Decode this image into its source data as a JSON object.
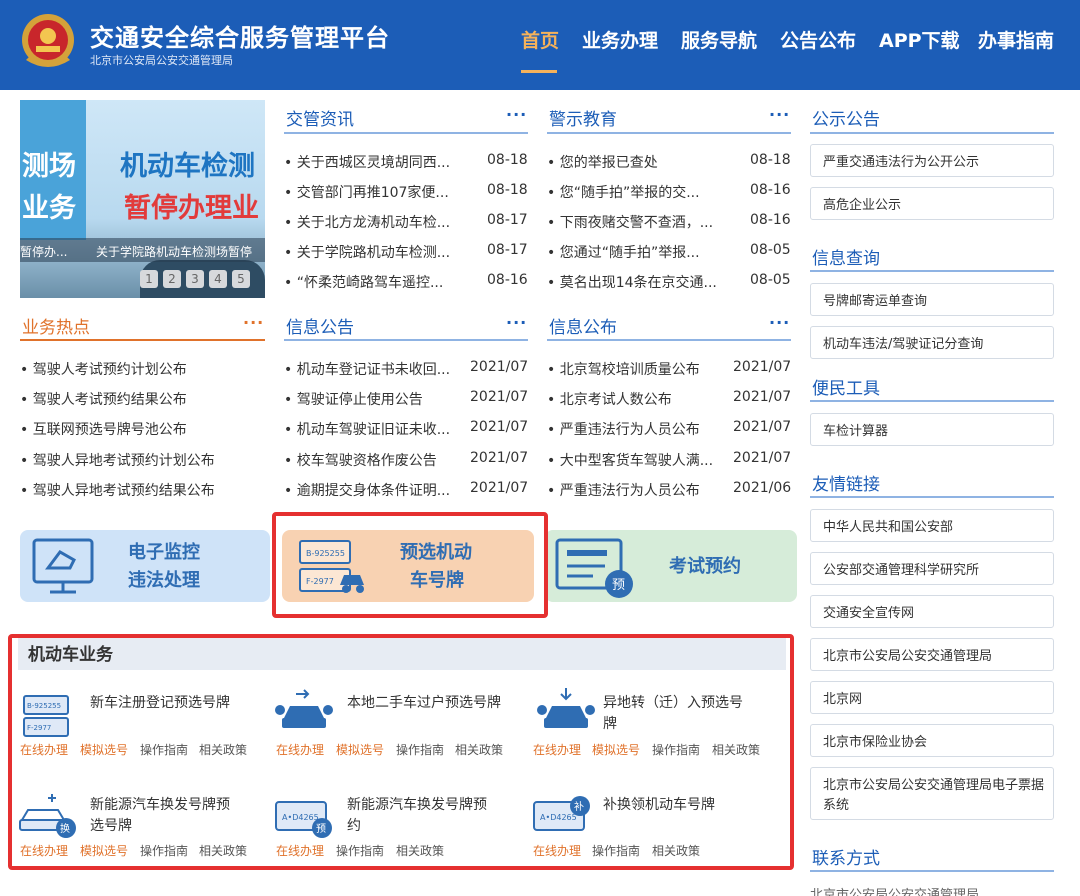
{
  "header": {
    "title": "交通安全综合服务管理平台",
    "subtitle": "北京市公安局公安交通管理局",
    "nav": [
      "首页",
      "业务办理",
      "服务导航",
      "公告公布",
      "APP下载",
      "办事指南"
    ]
  },
  "banner": {
    "line1": "机动车检测",
    "line2": "暂停办理业",
    "side1": "测场",
    "side2": "业务",
    "caption_left": "暂停办...",
    "caption": "关于学院路机动车检测场暂停",
    "pages": [
      "1",
      "2",
      "3",
      "4",
      "5"
    ]
  },
  "hot": {
    "title": "业务热点",
    "more": "···",
    "items": [
      "• 驾驶人考试预约计划公布",
      "• 驾驶人考试预约结果公布",
      "• 互联网预选号牌号池公布",
      "• 驾驶人异地考试预约计划公布",
      "• 驾驶人异地考试预约结果公布"
    ]
  },
  "jiaoguan": {
    "title": "交管资讯",
    "more": "···",
    "items": [
      {
        "title": "• 关于西城区灵境胡同西...",
        "date": "08-18"
      },
      {
        "title": "• 交管部门再推107家便...",
        "date": "08-18"
      },
      {
        "title": "• 关于北方龙涛机动车检...",
        "date": "08-17"
      },
      {
        "title": "• 关于学院路机动车检测...",
        "date": "08-17"
      },
      {
        "title": "• “怀柔范崎路驾车遥控...",
        "date": "08-16"
      }
    ]
  },
  "jingshi": {
    "title": "警示教育",
    "more": "···",
    "items": [
      {
        "title": "• 您的举报已查处",
        "date": "08-18"
      },
      {
        "title": "• 您“随手拍”举报的交...",
        "date": "08-16"
      },
      {
        "title": "• 下雨夜赌交警不查酒，...",
        "date": "08-16"
      },
      {
        "title": "• 您通过“随手拍”举报...",
        "date": "08-05"
      },
      {
        "title": "• 莫名出现14条在京交通...",
        "date": "08-05"
      }
    ]
  },
  "xinxi_gonggao": {
    "title": "信息公告",
    "more": "···",
    "items": [
      {
        "title": "• 机动车登记证书未收回...",
        "date": "2021/07"
      },
      {
        "title": "• 驾驶证停止使用公告",
        "date": "2021/07"
      },
      {
        "title": "• 机动车驾驶证旧证未收...",
        "date": "2021/07"
      },
      {
        "title": "• 校车驾驶资格作废公告",
        "date": "2021/07"
      },
      {
        "title": "• 逾期提交身体条件证明...",
        "date": "2021/07"
      }
    ]
  },
  "xinxi_gongbu": {
    "title": "信息公布",
    "more": "···",
    "items": [
      {
        "title": "• 北京驾校培训质量公布",
        "date": "2021/07"
      },
      {
        "title": "• 北京考试人数公布",
        "date": "2021/07"
      },
      {
        "title": "• 严重违法行为人员公布",
        "date": "2021/07"
      },
      {
        "title": "• 大中型客货车驾驶人满...",
        "date": "2021/07"
      },
      {
        "title": "• 严重违法行为人员公布",
        "date": "2021/06"
      }
    ]
  },
  "right": {
    "gongshi_title": "公示公告",
    "gongshi": [
      "严重交通违法行为公开公示",
      "高危企业公示"
    ],
    "chaxun_title": "信息查询",
    "chaxun": [
      "号牌邮寄运单查询",
      "机动车违法/驾驶证记分查询"
    ],
    "tools_title": "便民工具",
    "tools": [
      "车检计算器"
    ],
    "links_title": "友情链接",
    "links": [
      "中华人民共和国公安部",
      "公安部交通管理科学研究所",
      "交通安全宣传网",
      "北京市公安局公安交通管理局",
      "北京网",
      "北京市保险业协会",
      "北京市公安局公安交通管理局电子票据系统"
    ],
    "contact_title": "联系方式",
    "contact_text": "北京市公安局公安交通管理局"
  },
  "services": {
    "monitor_line1": "电子监控",
    "monitor_line2": "违法处理",
    "plate_line1": "预选机动",
    "plate_line2": "车号牌",
    "plate_icon_text1": "B-925255",
    "plate_icon_text2": "F-2977",
    "exam": "考试预约",
    "exam_badge": "预"
  },
  "motor": {
    "title": "机动车业务",
    "items": [
      {
        "name": "新车注册登记预选号牌",
        "links": [
          "在线办理",
          "模拟选号",
          "操作指南",
          "相关政策"
        ]
      },
      {
        "name": "本地二手车过户预选号牌",
        "links": [
          "在线办理",
          "模拟选号",
          "操作指南",
          "相关政策"
        ]
      },
      {
        "name": "异地转（迁）入预选号牌",
        "links": [
          "在线办理",
          "模拟选号",
          "操作指南",
          "相关政策"
        ]
      },
      {
        "name": "新能源汽车换发号牌预选号牌",
        "links": [
          "在线办理",
          "模拟选号",
          "操作指南",
          "相关政策"
        ]
      },
      {
        "name": "新能源汽车换发号牌预约",
        "links": [
          "在线办理",
          "操作指南",
          "相关政策"
        ]
      },
      {
        "name": "补换领机动车号牌",
        "links": [
          "在线办理",
          "操作指南",
          "相关政策"
        ]
      }
    ],
    "icon_texts": {
      "plate_a": "B-925255",
      "plate_b": "F-2977",
      "plate_c": "A•D4265",
      "badge_huan": "换",
      "badge_yu": "预",
      "badge_bu": "补"
    }
  },
  "colors": {
    "header_bg": "#1c5db7",
    "accent_orange": "#e0722b",
    "highlight": "#e53030"
  }
}
